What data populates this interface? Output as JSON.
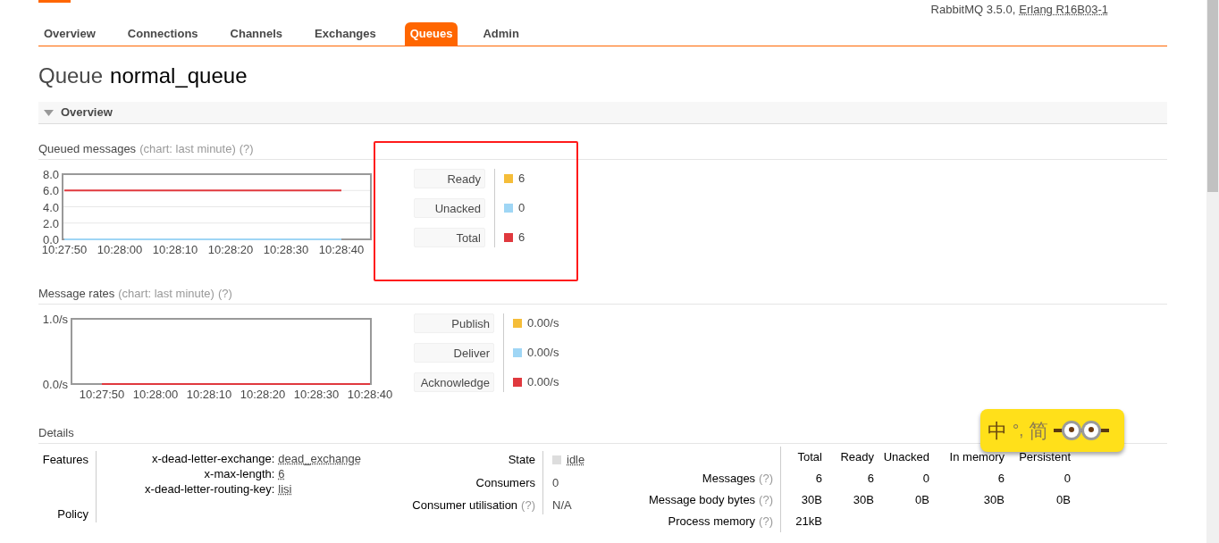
{
  "header": {
    "version": "RabbitMQ 3.5.0,",
    "erlang": "Erlang R16B03-1"
  },
  "tabs": [
    {
      "label": "Overview",
      "selected": false
    },
    {
      "label": "Connections",
      "selected": false
    },
    {
      "label": "Channels",
      "selected": false
    },
    {
      "label": "Exchanges",
      "selected": false
    },
    {
      "label": "Queues",
      "selected": true
    },
    {
      "label": "Admin",
      "selected": false
    }
  ],
  "title": {
    "prefix": "Queue",
    "name": "normal_queue"
  },
  "section": {
    "label": "Overview",
    "expanded": true
  },
  "queued_messages": {
    "label": "Queued messages",
    "note": "(chart: last minute)",
    "help": "(?)",
    "chart_data": {
      "type": "line",
      "grid": true,
      "categories": [
        "10:27:50",
        "10:28:00",
        "10:28:10",
        "10:28:20",
        "10:28:30",
        "10:28:40"
      ],
      "ylim": [
        0,
        8
      ],
      "yticks": [
        {
          "value": 0,
          "label": "0.0"
        },
        {
          "value": 2,
          "label": "2.0"
        },
        {
          "value": 4,
          "label": "4.0"
        },
        {
          "value": 6,
          "label": "6.0"
        },
        {
          "value": 8,
          "label": "8.0"
        }
      ],
      "series": [
        {
          "name": "Ready",
          "color": "#f5bd39",
          "values": [
            null,
            null,
            null,
            null,
            null,
            null
          ]
        },
        {
          "name": "Unacked",
          "color": "#9fd6f5",
          "values": [
            0,
            0,
            0,
            0,
            0,
            0
          ]
        },
        {
          "name": "Total",
          "color": "#e0393e",
          "values": [
            6,
            6,
            6,
            6,
            6,
            6
          ]
        }
      ]
    },
    "legend": [
      {
        "value": "6"
      },
      {
        "value": "0"
      },
      {
        "value": "6"
      }
    ]
  },
  "message_rates": {
    "label": "Message rates",
    "note": "(chart: last minute)",
    "help": "(?)",
    "chart_data": {
      "type": "line",
      "categories": [
        "10:27:50",
        "10:28:00",
        "10:28:10",
        "10:28:20",
        "10:28:30",
        "10:28:40"
      ],
      "ylim": [
        0,
        1
      ],
      "yticks": [
        {
          "value": 0,
          "label": "0.0/s"
        },
        {
          "value": 1,
          "label": "1.0/s"
        }
      ],
      "series": [
        {
          "name": "Publish",
          "color": "#f5bd39",
          "values": [
            null,
            null,
            null,
            null,
            null,
            null
          ]
        },
        {
          "name": "Deliver",
          "color": "#9fd6f5",
          "values": [
            null,
            null,
            null,
            null,
            null,
            null
          ]
        },
        {
          "name": "Acknowledge",
          "color": "#e0393e",
          "values": [
            0,
            0,
            0,
            0,
            0,
            0
          ]
        }
      ]
    },
    "legend": [
      {
        "value": "0.00/s"
      },
      {
        "value": "0.00/s"
      },
      {
        "value": "0.00/s"
      }
    ]
  },
  "details": {
    "label": "Details",
    "features_label": "Features",
    "policy_label": "Policy",
    "features": [
      {
        "key": "x-dead-letter-exchange:",
        "value": "dead_exchange"
      },
      {
        "key": "x-max-length:",
        "value": "6"
      },
      {
        "key": "x-dead-letter-routing-key:",
        "value": "lisi"
      }
    ],
    "state": {
      "label": "State",
      "value": "idle"
    },
    "consumers": {
      "label": "Consumers",
      "value": "0"
    },
    "utilisation": {
      "label": "Consumer utilisation",
      "help": "(?)",
      "value": "N/A"
    },
    "columns": [
      "Total",
      "Ready",
      "Unacked",
      "In memory",
      "Persistent"
    ],
    "rows": [
      {
        "label": "Messages",
        "help": "(?)",
        "cells": [
          "6",
          "6",
          "0",
          "6",
          "0"
        ]
      },
      {
        "label": "Message body bytes",
        "help": "(?)",
        "cells": [
          "30B",
          "30B",
          "0B",
          "30B",
          "0B"
        ]
      },
      {
        "label": "Process memory",
        "help": "(?)",
        "cells": [
          "21kB"
        ]
      }
    ]
  },
  "ime_toolbar": {
    "items": [
      "中",
      "°,",
      "简"
    ]
  }
}
